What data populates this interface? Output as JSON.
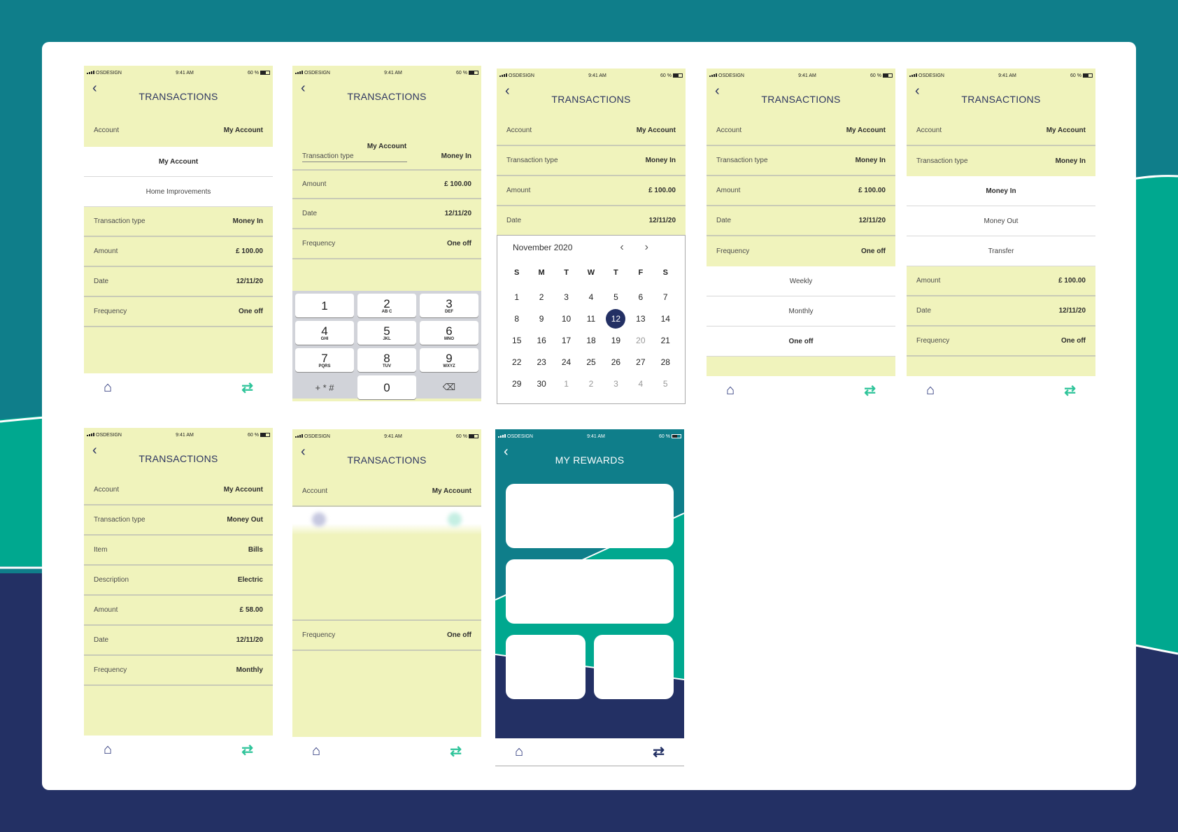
{
  "colors": {
    "navy": "#233064",
    "teal": "#0f7e8a",
    "green": "#2fc49a",
    "yellow": "#f0f3bc"
  },
  "status": {
    "carrier": "OSDESIGN",
    "time": "9:41 AM",
    "battery": "60 %"
  },
  "icons": {
    "back": "chevron-left-icon",
    "home": "home-icon",
    "swap": "swap-arrows-icon",
    "backspace": "backspace-icon"
  },
  "s1": {
    "title": "TRANSACTIONS",
    "account_label": "Account",
    "account_value": "My Account",
    "options": [
      "My Account",
      "Home Improvements"
    ],
    "rows": [
      {
        "label": "Transaction type",
        "value": "Money In"
      },
      {
        "label": "Amount",
        "value": "£ 100.00"
      },
      {
        "label": "Date",
        "value": "12/11/20"
      },
      {
        "label": "Frequency",
        "value": "One off"
      }
    ]
  },
  "s2": {
    "title": "TRANSACTIONS",
    "floating": "My Account",
    "type_label": "Transaction type",
    "type_value": "Money In",
    "rows": [
      {
        "label": "Amount",
        "value": "£ 100.00"
      },
      {
        "label": "Date",
        "value": "12/11/20"
      },
      {
        "label": "Frequency",
        "value": "One off"
      }
    ],
    "keys": [
      {
        "n": "1",
        "l": ""
      },
      {
        "n": "2",
        "l": "AB C"
      },
      {
        "n": "3",
        "l": "DEF"
      },
      {
        "n": "4",
        "l": "GHI"
      },
      {
        "n": "5",
        "l": "JKL"
      },
      {
        "n": "6",
        "l": "MNO"
      },
      {
        "n": "7",
        "l": "PQRS"
      },
      {
        "n": "8",
        "l": "TUV"
      },
      {
        "n": "9",
        "l": "WXYZ"
      }
    ],
    "sym": "+ * #",
    "zero": "0"
  },
  "s3": {
    "title": "TRANSACTIONS",
    "rows": [
      {
        "label": "Account",
        "value": "My Account"
      },
      {
        "label": "Transaction type",
        "value": "Money In"
      },
      {
        "label": "Amount",
        "value": "£ 100.00"
      },
      {
        "label": "Date",
        "value": "12/11/20"
      }
    ],
    "month": "November 2020",
    "dow": [
      "S",
      "M",
      "T",
      "W",
      "T",
      "F",
      "S"
    ],
    "days": [
      "1",
      "2",
      "3",
      "4",
      "5",
      "6",
      "7",
      "8",
      "9",
      "10",
      "11",
      "12",
      "13",
      "14",
      "15",
      "16",
      "17",
      "18",
      "19",
      "20",
      "21",
      "22",
      "23",
      "24",
      "25",
      "26",
      "27",
      "28",
      "29",
      "30",
      "1",
      "2",
      "3",
      "4",
      "5"
    ],
    "selected": "12"
  },
  "s4": {
    "title": "TRANSACTIONS",
    "rows": [
      {
        "label": "Account",
        "value": "My Account"
      },
      {
        "label": "Transaction type",
        "value": "Money In"
      },
      {
        "label": "Amount",
        "value": "£ 100.00"
      },
      {
        "label": "Date",
        "value": "12/11/20"
      },
      {
        "label": "Frequency",
        "value": "One off"
      }
    ],
    "options": [
      "Weekly",
      "Monthly",
      "One off"
    ]
  },
  "s5": {
    "title": "TRANSACTIONS",
    "rows_top": [
      {
        "label": "Account",
        "value": "My Account"
      },
      {
        "label": "Transaction type",
        "value": "Money In"
      }
    ],
    "options": [
      "Money In",
      "Money Out",
      "Transfer"
    ],
    "rows_bottom": [
      {
        "label": "Amount",
        "value": "£ 100.00"
      },
      {
        "label": "Date",
        "value": "12/11/20"
      },
      {
        "label": "Frequency",
        "value": "One off"
      }
    ]
  },
  "s6": {
    "title": "TRANSACTIONS",
    "rows": [
      {
        "label": "Account",
        "value": "My Account"
      },
      {
        "label": "Transaction type",
        "value": "Money Out"
      },
      {
        "label": "Item",
        "value": "Bills"
      },
      {
        "label": "Description",
        "value": "Electric"
      },
      {
        "label": "Amount",
        "value": "£ 58.00"
      },
      {
        "label": "Date",
        "value": "12/11/20"
      },
      {
        "label": "Frequency",
        "value": "Monthly"
      }
    ]
  },
  "s7": {
    "title": "TRANSACTIONS",
    "account_label": "Account",
    "account_value": "My Account",
    "freq_label": "Frequency",
    "freq_value": "One off"
  },
  "s8": {
    "title": "MY REWARDS"
  }
}
